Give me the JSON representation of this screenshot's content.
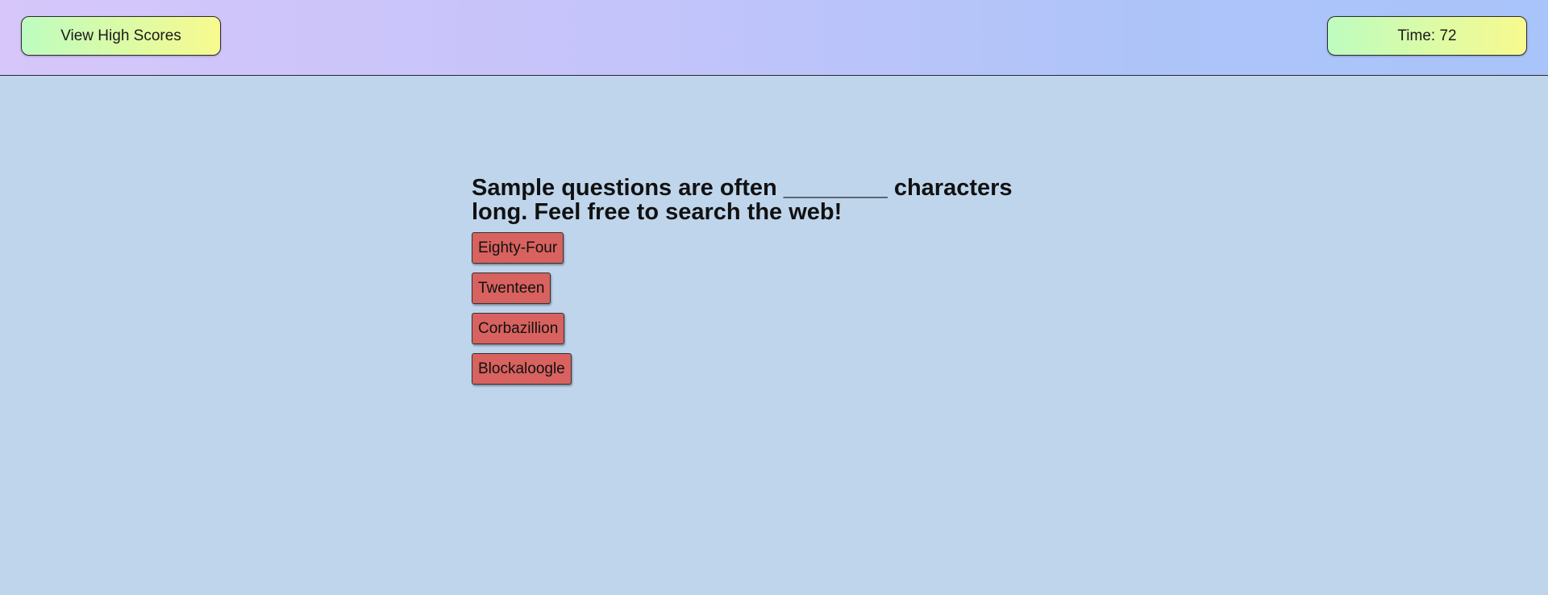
{
  "header": {
    "high_scores_label": "View High Scores",
    "timer_label": "Time: 72"
  },
  "quiz": {
    "question": "Sample questions are often ________ characters long. Feel free to search the web!",
    "answers": [
      {
        "label": "Eighty-Four"
      },
      {
        "label": "Twenteen"
      },
      {
        "label": "Corbazillion"
      },
      {
        "label": "Blockaloogle"
      }
    ]
  },
  "colors": {
    "page_background": "#bfd5ec",
    "answer_button": "#d8625f",
    "pill_gradient_start": "#bdfcc0",
    "pill_gradient_end": "#f8fa8e"
  }
}
